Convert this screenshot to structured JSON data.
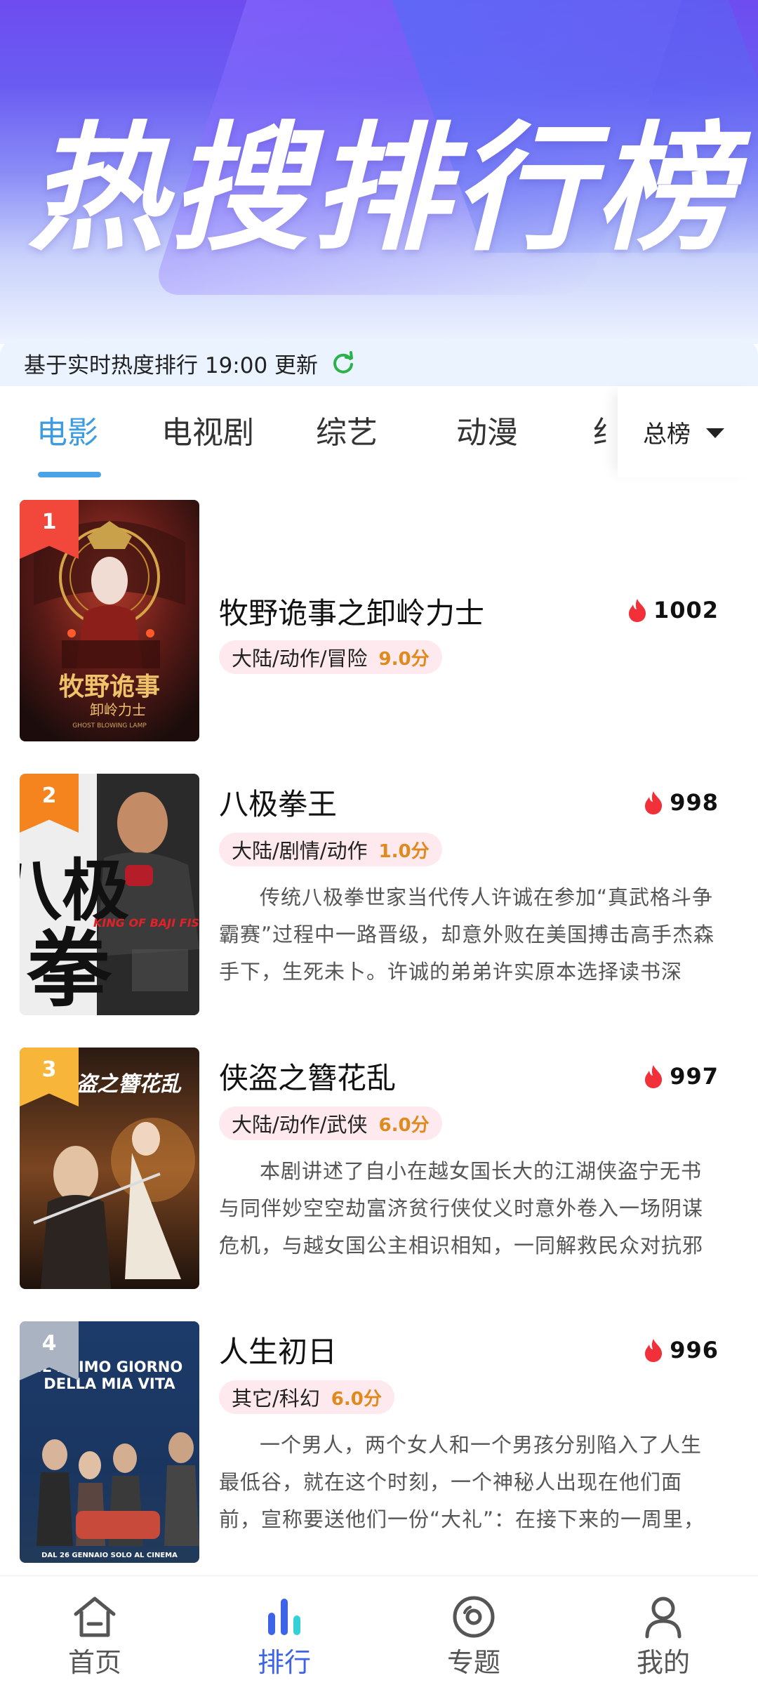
{
  "banner": {
    "title": "热搜排行榜"
  },
  "update_bar": {
    "text": "基于实时热度排行 19:00 更新",
    "icon": "refresh-icon"
  },
  "tabs": [
    {
      "label": "电影",
      "active": true
    },
    {
      "label": "电视剧",
      "active": false
    },
    {
      "label": "综艺",
      "active": false
    },
    {
      "label": "动漫",
      "active": false
    }
  ],
  "total_filter": {
    "label": "总榜",
    "icon": "caret-down-icon"
  },
  "items": [
    {
      "rank": "1",
      "title": "牧野诡事之卸岭力士",
      "heat": "1002",
      "genre": "大陆/动作/冒险",
      "score": "9.0分",
      "description": "",
      "badge_color": "#f2473b"
    },
    {
      "rank": "2",
      "title": "八极拳王",
      "heat": "998",
      "genre": "大陆/剧情/动作",
      "score": "1.0分",
      "description": "传统八极拳世家当代传人许诚在参加“真武格斗争霸赛”过程中一路晋级，却意外败在美国搏击高手杰森手下，生死未卜。许诚的弟弟许实原本选择读书深造，在…",
      "badge_color": "#f5841f"
    },
    {
      "rank": "3",
      "title": "侠盗之簪花乱",
      "heat": "997",
      "genre": "大陆/动作/武侠",
      "score": "6.0分",
      "description": "本剧讲述了自小在越女国长大的江湖侠盗宁无书与同伴妙空空劫富济贫行侠仗义时意外卷入一场阴谋危机，与越女国公主相识相知，一同解救民众对抗邪恶势力化解…",
      "badge_color": "#f7b53a"
    },
    {
      "rank": "4",
      "title": "人生初日",
      "heat": "996",
      "genre": "其它/科幻",
      "score": "6.0分",
      "description": "一个男人，两个女人和一个男孩分别陷入了人生最低谷，就在这个时刻，一个神秘人出现在他们面前，宣称要送他们一份“大礼”：在接下来的一周里，他们的存在会…",
      "badge_color": "#a9b3c2"
    }
  ],
  "posters": [
    {
      "text_line1": "牧野诡事",
      "text_line2": "卸岭力士",
      "text_line3": "GHOST BLOWING LAMP"
    },
    {
      "text_line1": "八极",
      "text_line2": "拳",
      "text_line3": "KING OF BAJI FIST"
    },
    {
      "text_line1": "侠盗之簪花乱",
      "text_line2": "",
      "text_line3": ""
    },
    {
      "text_line1": "IL PRIMO GIORNO",
      "text_line2": "DELLA MIA VITA",
      "text_line3": "DAL 26 GENNAIO SOLO AL CINEMA"
    }
  ],
  "bottom_nav": [
    {
      "label": "首页",
      "icon": "home-icon",
      "active": false
    },
    {
      "label": "排行",
      "icon": "rank-chart-icon",
      "active": true
    },
    {
      "label": "专题",
      "icon": "disc-icon",
      "active": false
    },
    {
      "label": "我的",
      "icon": "user-icon",
      "active": false
    }
  ]
}
